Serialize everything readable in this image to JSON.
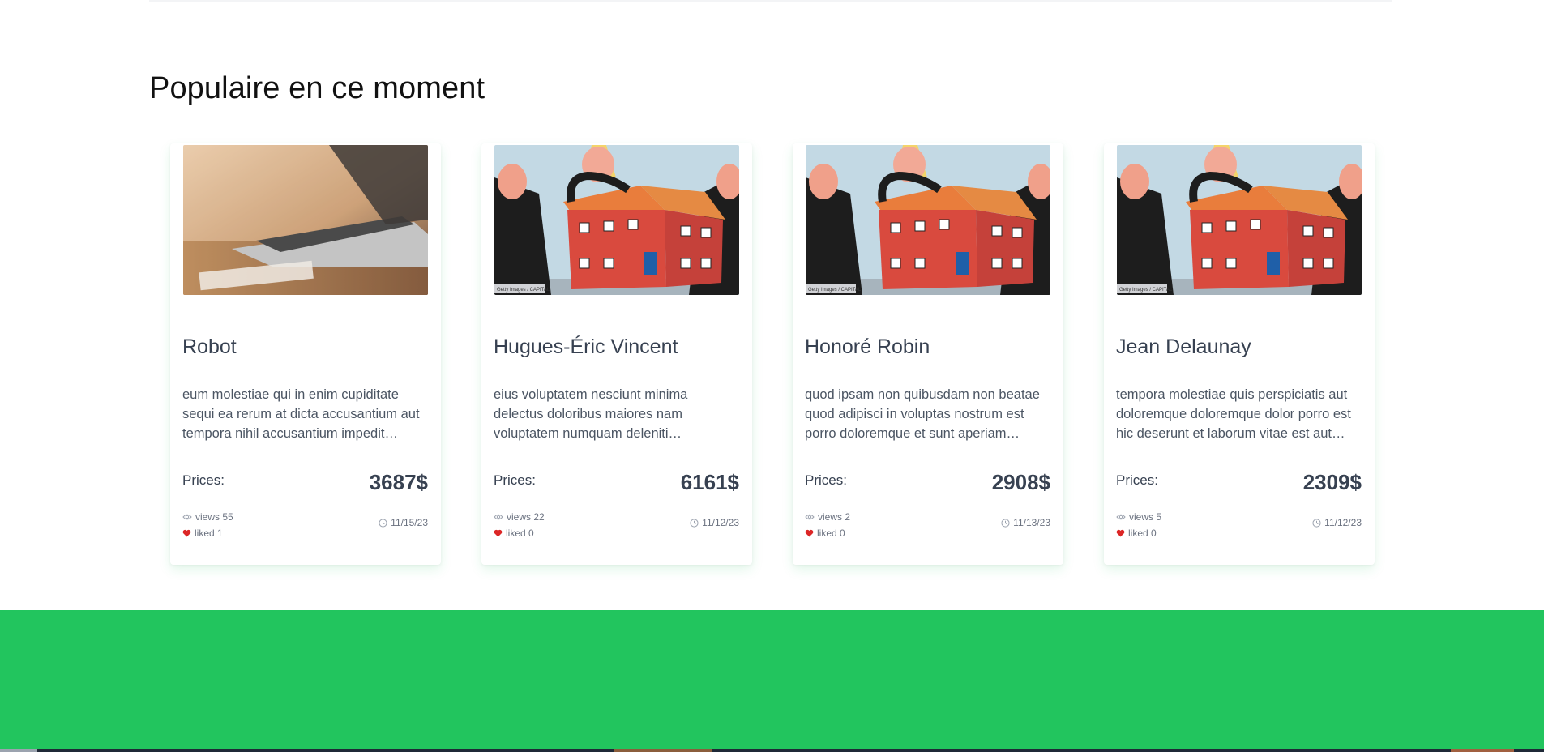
{
  "section": {
    "title": "Populaire en ce moment"
  },
  "cards": [
    {
      "title": "Robot",
      "description": "eum molestiae qui in enim cupiditate sequi ea rerum at dicta accusantium aut tempora nihil accusantium impedit…",
      "price_label": "Prices:",
      "price": "3687$",
      "views": "views 55",
      "liked": "liked 1",
      "date": "11/15/23",
      "image": "laptop-photo"
    },
    {
      "title": "Hugues-Éric Vincent",
      "description": "eius voluptatem nesciunt minima delectus doloribus maiores nam voluptatem numquam deleniti…",
      "price_label": "Prices:",
      "price": "6161$",
      "views": "views 22",
      "liked": "liked 0",
      "date": "11/12/23",
      "image": "house-illustration"
    },
    {
      "title": "Honoré Robin",
      "description": "quod ipsam non quibusdam non beatae quod adipisci in voluptas nostrum est porro doloremque et sunt aperiam…",
      "price_label": "Prices:",
      "price": "2908$",
      "views": "views 2",
      "liked": "liked 0",
      "date": "11/13/23",
      "image": "house-illustration"
    },
    {
      "title": "Jean Delaunay",
      "description": "tempora molestiae quis perspiciatis aut doloremque doloremque dolor porro est hic deserunt et laborum vitae est aut…",
      "price_label": "Prices:",
      "price": "2309$",
      "views": "views 5",
      "liked": "liked 0",
      "date": "11/12/23",
      "image": "house-illustration"
    }
  ],
  "image_caption": "Getty Images / CAPITAL",
  "icons": {
    "views": "eye-icon",
    "liked": "heart-icon",
    "date": "clock-icon"
  },
  "colors": {
    "accent": "#22c55e",
    "heart": "#dc2626",
    "text": "#374151",
    "muted": "#6b7280"
  }
}
